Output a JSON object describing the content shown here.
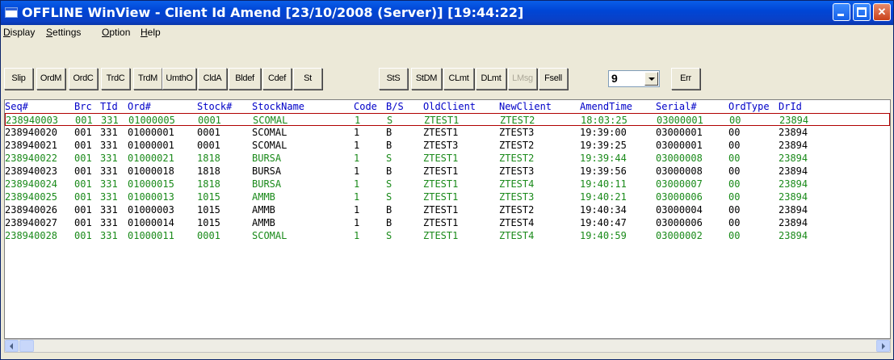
{
  "window": {
    "title": "OFFLINE WinView - Client Id Amend [23/10/2008 (Server)]  [19:44:22]"
  },
  "menu": [
    "Display",
    "Settings",
    "Option",
    "Help"
  ],
  "toolbar": {
    "buttons": [
      "Slip",
      "OrdM",
      "OrdC",
      "TrdC",
      "TrdM",
      "UmthO",
      "CldA",
      "Bldef",
      "Cdef",
      "St",
      "StS",
      "StDM",
      "CLmt",
      "DLmt",
      "LMsg",
      "Fsell",
      "Err"
    ],
    "combo_value": "9"
  },
  "table": {
    "headers": [
      "Seq#",
      "Brc",
      "TId",
      "Ord#",
      "Stock#",
      "StockName",
      "Code",
      "B/S",
      "OldClient",
      "NewClient",
      "AmendTime",
      "Serial#",
      "OrdType",
      "DrId"
    ],
    "rows": [
      [
        "238940003",
        "001",
        "331",
        "01000005",
        "0001",
        "SCOMAL",
        "1",
        "S",
        "ZTEST1",
        "ZTEST2",
        "18:03:25",
        "03000001",
        "00",
        "23894"
      ],
      [
        "238940020",
        "001",
        "331",
        "01000001",
        "0001",
        "SCOMAL",
        "1",
        "B",
        "ZTEST1",
        "ZTEST3",
        "19:39:00",
        "03000001",
        "00",
        "23894"
      ],
      [
        "238940021",
        "001",
        "331",
        "01000001",
        "0001",
        "SCOMAL",
        "1",
        "B",
        "ZTEST3",
        "ZTEST2",
        "19:39:25",
        "03000001",
        "00",
        "23894"
      ],
      [
        "238940022",
        "001",
        "331",
        "01000021",
        "1818",
        "BURSA",
        "1",
        "S",
        "ZTEST1",
        "ZTEST2",
        "19:39:44",
        "03000008",
        "00",
        "23894"
      ],
      [
        "238940023",
        "001",
        "331",
        "01000018",
        "1818",
        "BURSA",
        "1",
        "B",
        "ZTEST1",
        "ZTEST3",
        "19:39:56",
        "03000008",
        "00",
        "23894"
      ],
      [
        "238940024",
        "001",
        "331",
        "01000015",
        "1818",
        "BURSA",
        "1",
        "S",
        "ZTEST1",
        "ZTEST4",
        "19:40:11",
        "03000007",
        "00",
        "23894"
      ],
      [
        "238940025",
        "001",
        "331",
        "01000013",
        "1015",
        "AMMB",
        "1",
        "S",
        "ZTEST1",
        "ZTEST3",
        "19:40:21",
        "03000006",
        "00",
        "23894"
      ],
      [
        "238940026",
        "001",
        "331",
        "01000003",
        "1015",
        "AMMB",
        "1",
        "B",
        "ZTEST1",
        "ZTEST2",
        "19:40:34",
        "03000004",
        "00",
        "23894"
      ],
      [
        "238940027",
        "001",
        "331",
        "01000014",
        "1015",
        "AMMB",
        "1",
        "B",
        "ZTEST1",
        "ZTEST4",
        "19:40:47",
        "03000006",
        "00",
        "23894"
      ],
      [
        "238940028",
        "001",
        "331",
        "01000011",
        "0001",
        "SCOMAL",
        "1",
        "S",
        "ZTEST1",
        "ZTEST4",
        "19:40:59",
        "03000002",
        "00",
        "23894"
      ]
    ]
  },
  "colors": {
    "header_text": "#0000c8",
    "sell_row_text": "#1a8a1a",
    "buy_row_text": "#000000",
    "selected_row_border": "#b00000"
  }
}
